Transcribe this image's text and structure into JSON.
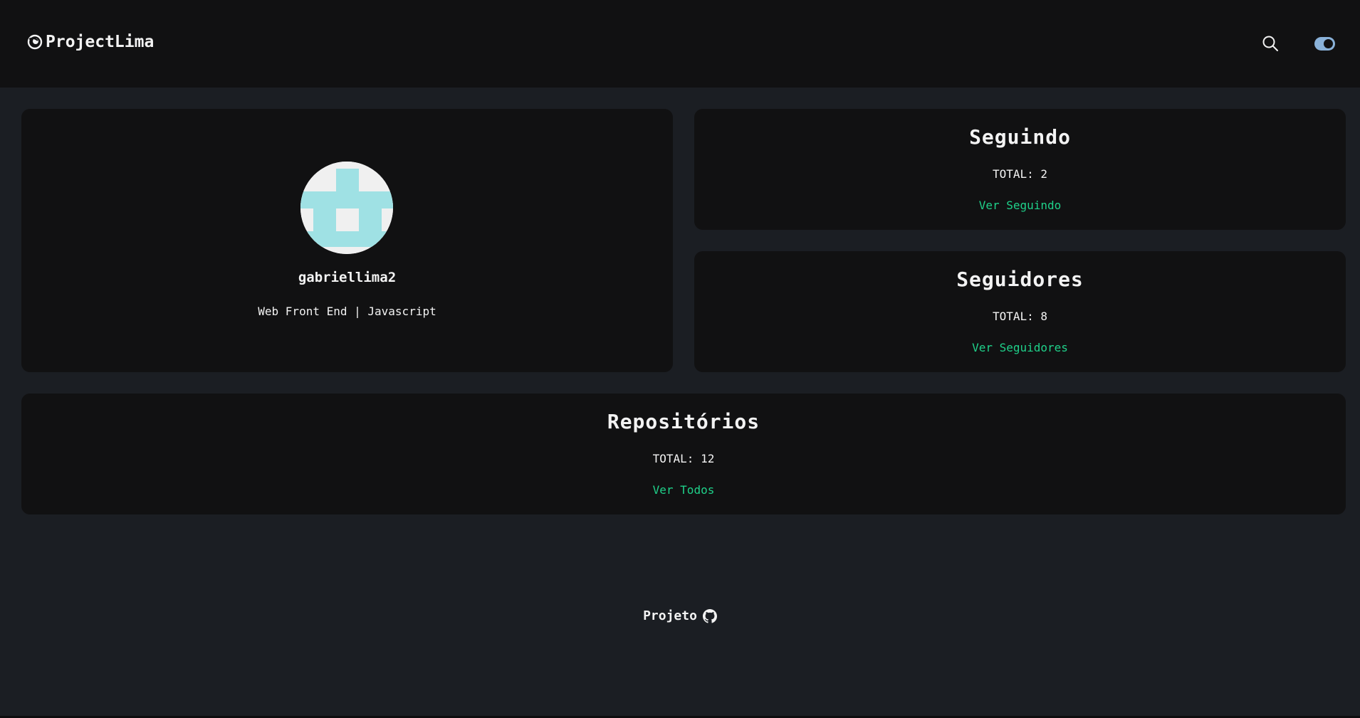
{
  "header": {
    "brand": "ProjectLima",
    "logo_icon": "spiral-logo-icon",
    "search_icon": "search-icon",
    "theme_toggle": {
      "state": "on",
      "color": "#8ab2d9"
    }
  },
  "profile": {
    "username": "gabriellima2",
    "bio": "Web Front End | Javascript",
    "avatar_colors": {
      "primary": "#9fe1e4",
      "background": "#f0f0f0"
    }
  },
  "following": {
    "title": "Seguindo",
    "total": "TOTAL: 2",
    "link": "Ver Seguindo"
  },
  "followers": {
    "title": "Seguidores",
    "total": "TOTAL: 8",
    "link": "Ver Seguidores"
  },
  "repositories": {
    "title": "Repositórios",
    "total": "TOTAL: 12",
    "link": "Ver Todos"
  },
  "footer": {
    "label": "Projeto",
    "icon": "github-icon"
  },
  "colors": {
    "background": "#1b1e23",
    "card": "#111112",
    "accent": "#1fd18a",
    "text": "#f3f3f3"
  }
}
